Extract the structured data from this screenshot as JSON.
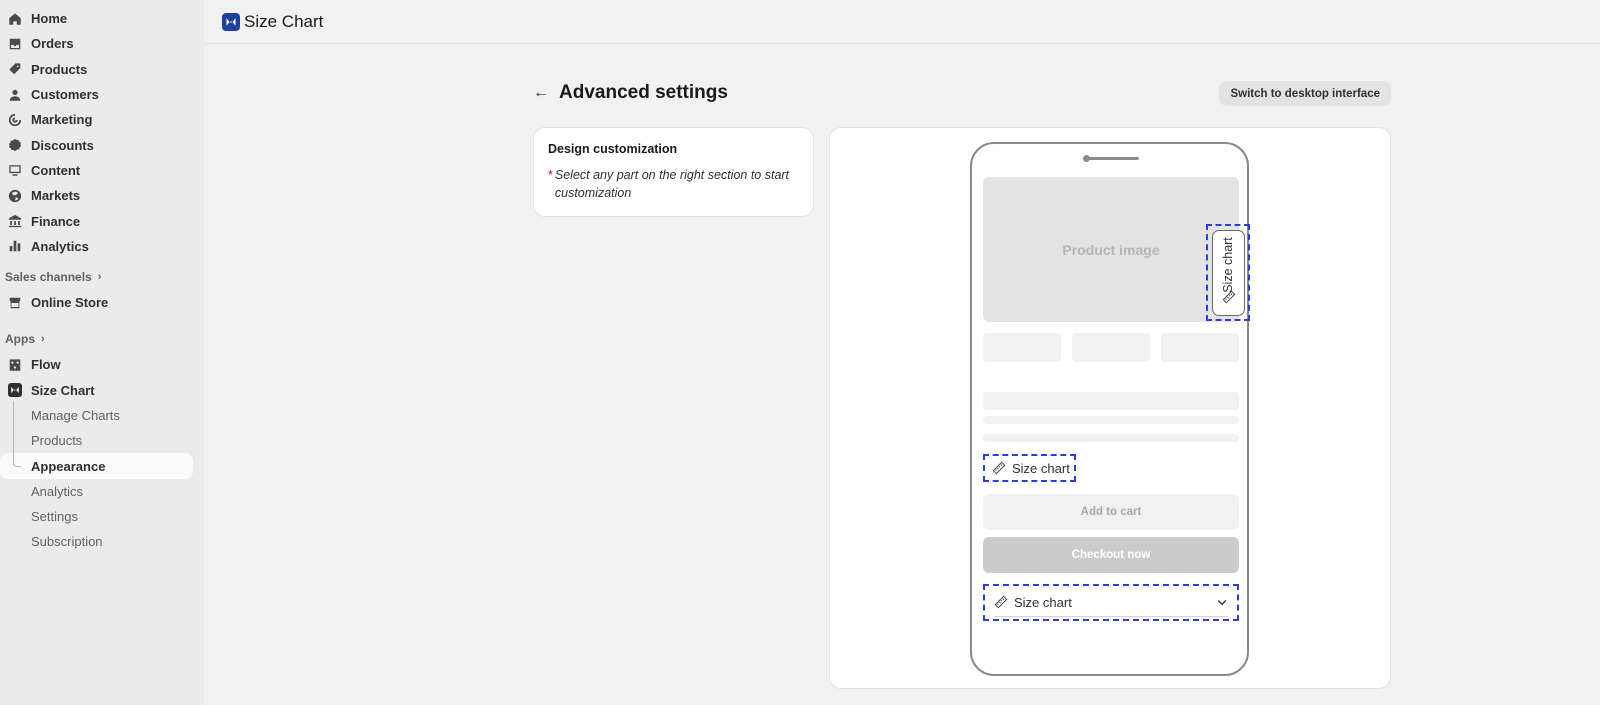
{
  "sidebar": {
    "main_items": [
      {
        "label": "Home",
        "icon": "home-icon"
      },
      {
        "label": "Orders",
        "icon": "orders-icon"
      },
      {
        "label": "Products",
        "icon": "tag-icon"
      },
      {
        "label": "Customers",
        "icon": "person-icon"
      },
      {
        "label": "Marketing",
        "icon": "target-icon"
      },
      {
        "label": "Discounts",
        "icon": "discount-icon"
      },
      {
        "label": "Content",
        "icon": "content-icon"
      },
      {
        "label": "Markets",
        "icon": "globe-icon"
      },
      {
        "label": "Finance",
        "icon": "bank-icon"
      },
      {
        "label": "Analytics",
        "icon": "bar-chart-icon"
      }
    ],
    "sales_channels_label": "Sales channels",
    "online_store_label": "Online Store",
    "apps_label": "Apps",
    "flow_label": "Flow",
    "size_chart_label": "Size Chart",
    "size_chart_sub": [
      {
        "label": "Manage Charts"
      },
      {
        "label": "Products"
      },
      {
        "label": "Appearance"
      },
      {
        "label": "Analytics"
      },
      {
        "label": "Settings"
      },
      {
        "label": "Subscription"
      }
    ],
    "active_sub": "Appearance"
  },
  "topbar": {
    "app_title": "Size Chart"
  },
  "page": {
    "title": "Advanced settings",
    "switch_button": "Switch to desktop interface"
  },
  "design_card": {
    "title": "Design customization",
    "hint_marker": "*",
    "hint": "Select any part on the right section to start customization"
  },
  "preview": {
    "product_image_label": "Product image",
    "side_tab_label": "Size chart",
    "inline_link_label": "Size chart",
    "add_to_cart": "Add to cart",
    "checkout": "Checkout now",
    "accordion_label": "Size chart"
  },
  "colors": {
    "highlight_dashed": "#2b3fd6",
    "brand": "#1f3f9d"
  }
}
